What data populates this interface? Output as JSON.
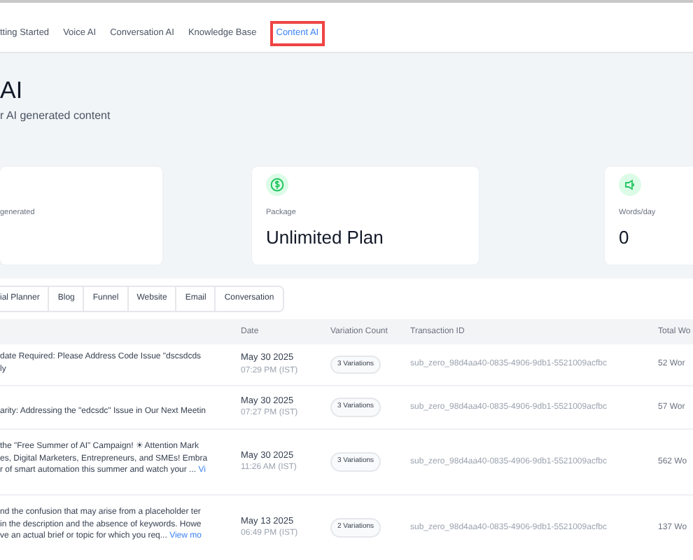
{
  "nav_tabs": [
    {
      "label": "tting Started",
      "selected": false
    },
    {
      "label": "Voice AI",
      "selected": false
    },
    {
      "label": "Conversation AI",
      "selected": false
    },
    {
      "label": "Knowledge Base",
      "selected": false
    },
    {
      "label": "Content AI",
      "selected": true
    }
  ],
  "header": {
    "title": "AI",
    "subtitle": "r AI generated content"
  },
  "stats": [
    {
      "kind": "none",
      "label": "generated"
    },
    {
      "kind": "dollar",
      "label": "Package",
      "value": "Unlimited Plan"
    },
    {
      "kind": "speaker",
      "label": "Words/day",
      "value": "0"
    }
  ],
  "filter_tabs": [
    {
      "label": "ial Planner",
      "selected": false
    },
    {
      "label": "Blog",
      "selected": false
    },
    {
      "label": "Funnel",
      "selected": false
    },
    {
      "label": "Website",
      "selected": false
    },
    {
      "label": "Email",
      "selected": false
    },
    {
      "label": "Conversation",
      "selected": false
    }
  ],
  "table": {
    "columns": [
      "Date",
      "Variation Count",
      "Transaction ID",
      "Total Wo"
    ],
    "rows": [
      {
        "lines": [
          "date Required: Please Address Code Issue \"dscsdcds",
          "ly"
        ],
        "link": "",
        "date": "May 30 2025",
        "time": "07:29 PM (IST)",
        "variations": "3 Variations",
        "transaction_id": "sub_zero_98d4aa40-0835-4906-9db1-5521009acfbc",
        "total_words": "52 Wor"
      },
      {
        "lines": [
          "arity: Addressing the \"edcsdc\" Issue in Our Next Meetin"
        ],
        "link": "",
        "date": "May 30 2025",
        "time": "07:27 PM (IST)",
        "variations": "3 Variations",
        "transaction_id": "sub_zero_98d4aa40-0835-4906-9db1-5521009acfbc",
        "total_words": "57 Wor"
      },
      {
        "lines": [
          "the \"Free Summer of AI\" Campaign! ☀ Attention Mark",
          "es, Digital Marketers, Entrepreneurs, and SMEs! Embra",
          "r of smart automation this summer and watch your ..."
        ],
        "link": "Vi",
        "date": "May 30 2025",
        "time": "11:26 AM (IST)",
        "variations": "3 Variations",
        "transaction_id": "sub_zero_98d4aa40-0835-4906-9db1-5521009acfbc",
        "total_words": "562 Wo"
      },
      {
        "lines": [
          "nd the confusion that may arise from a placeholder ter",
          "in the description and the absence of keywords. Howe",
          "ve an actual brief or topic for which you req..."
        ],
        "link": "View mo",
        "date": "May 13 2025",
        "time": "06:49 PM (IST)",
        "variations": "2 Variations",
        "transaction_id": "sub_zero_98d4aa40-0835-4906-9db1-5521009acfbc",
        "total_words": "137 Wo"
      }
    ]
  }
}
